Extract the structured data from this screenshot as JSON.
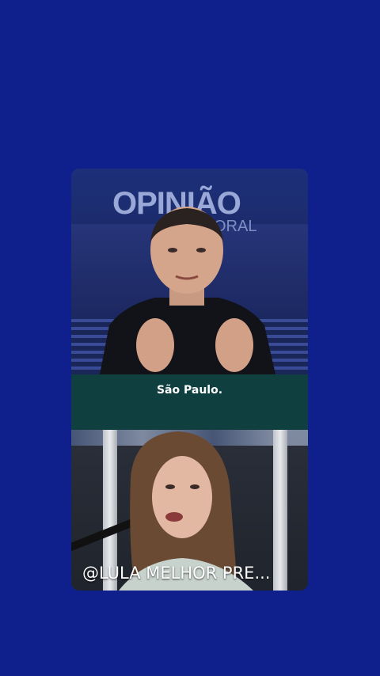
{
  "theme": {
    "background": "#0f1f8c",
    "caption_bar": "#0f3f3f"
  },
  "video_top": {
    "brand_title": "OPINIÃO",
    "brand_sub": "ORAL"
  },
  "caption": {
    "text": "São Paulo."
  },
  "video_bottom": {
    "overlay_text": "@LULA MELHOR PRE..."
  }
}
